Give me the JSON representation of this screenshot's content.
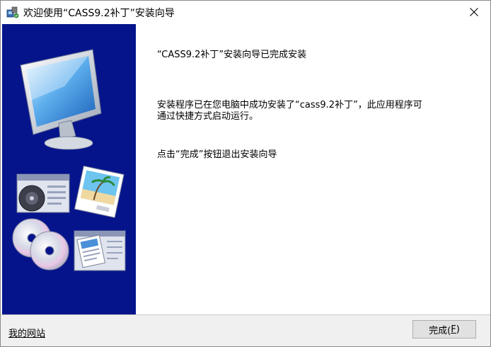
{
  "window": {
    "title": "欢迎使用“CASS9.2补丁”安装向导",
    "close_glyph": "✕"
  },
  "icons": {
    "app": "installer-icon",
    "close": "close-icon",
    "sidebar_art": [
      "monitor-icon",
      "media-player-icon",
      "photo-icon",
      "cd-disc-icon",
      "document-icon"
    ]
  },
  "main": {
    "heading": "“CASS9.2补丁”安装向导已完成安装",
    "body_line1": "安装程序已在您电脑中成功安装了“cass9.2补丁”，此应用程序可",
    "body_line2": "通过快捷方式启动运行。",
    "instruction": "点击“完成”按钮退出安装向导"
  },
  "footer": {
    "site_link": "我的网站",
    "finish_label": "完成(",
    "finish_accel": "F",
    "finish_suffix": ")"
  },
  "colors": {
    "sidebar_bg": "#06148c",
    "footer_bg": "#f0f0f0"
  }
}
